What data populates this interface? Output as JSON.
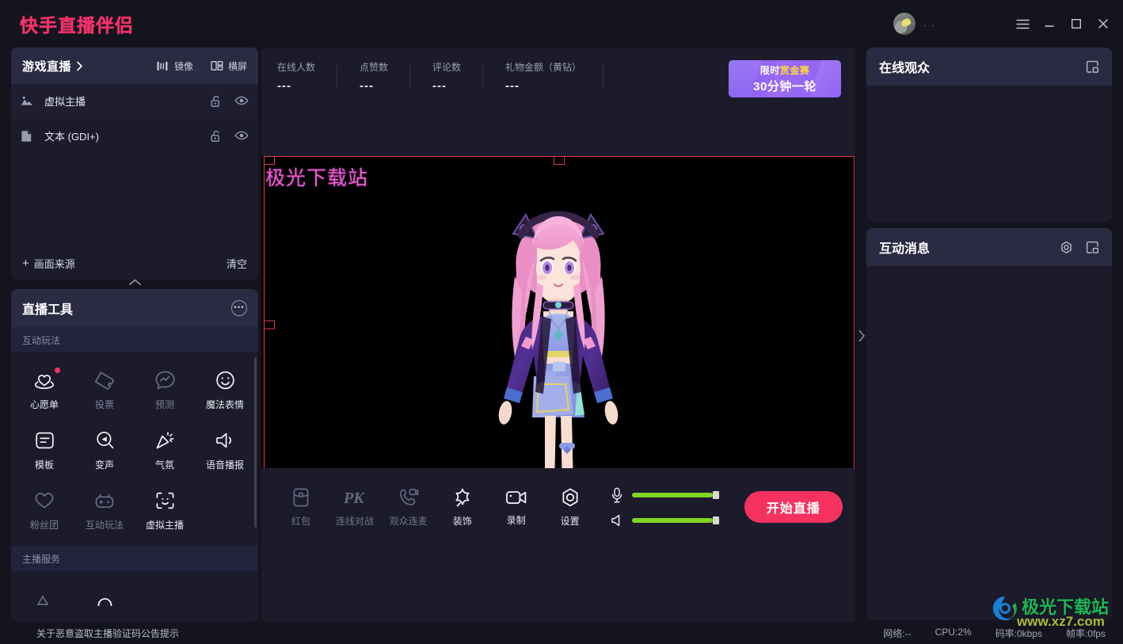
{
  "app": {
    "brand": "快手直播伴侣",
    "username": ". ."
  },
  "titlebar": {
    "menu_icon": "hamburger-menu-icon",
    "minimize_icon": "minimize-icon",
    "maximize_icon": "maximize-icon",
    "close_icon": "close-icon"
  },
  "sidebar": {
    "scene": {
      "title": "游戏直播",
      "chevron_icon": "chevron-right-icon",
      "actions": [
        {
          "label": "镜像",
          "icon": "mirror-icon"
        },
        {
          "label": "横屏",
          "icon": "landscape-icon"
        }
      ]
    },
    "sources": [
      {
        "name": "虚拟主播",
        "icon": "image-icon",
        "lock_icon": "unlock-icon",
        "eye_icon": "eye-visible-icon"
      },
      {
        "name": "文本 (GDI+)",
        "icon": "text-source-icon",
        "lock_icon": "unlock-icon",
        "eye_icon": "eye-visible-icon"
      }
    ],
    "sources_footer": {
      "add_label": "画面来源",
      "add_icon": "plus-icon",
      "clear_label": "清空"
    },
    "collapse_icon": "chevron-up-icon",
    "tools": {
      "title": "直播工具",
      "more_icon": "more-dots-icon",
      "groups": [
        {
          "label": "互动玩法",
          "items": [
            {
              "label": "心愿单",
              "icon": "wishlist-heart-icon",
              "dim": false,
              "badge": true
            },
            {
              "label": "投票",
              "icon": "vote-ticket-icon",
              "dim": true,
              "badge": false
            },
            {
              "label": "预测",
              "icon": "prediction-icon",
              "dim": true,
              "badge": false
            },
            {
              "label": "魔法表情",
              "icon": "magic-emoji-icon",
              "dim": false,
              "badge": false
            },
            {
              "label": "模板",
              "icon": "template-icon",
              "dim": false,
              "badge": false
            },
            {
              "label": "变声",
              "icon": "voice-changer-icon",
              "dim": false,
              "badge": false
            },
            {
              "label": "气氛",
              "icon": "confetti-icon",
              "dim": false,
              "badge": false
            },
            {
              "label": "语音播报",
              "icon": "speaker-announce-icon",
              "dim": false,
              "badge": false
            },
            {
              "label": "粉丝团",
              "icon": "fan-club-heart-icon",
              "dim": true,
              "badge": false
            },
            {
              "label": "互动玩法",
              "icon": "interactive-game-icon",
              "dim": true,
              "badge": false
            },
            {
              "label": "虚拟主播",
              "icon": "face-scan-icon",
              "dim": false,
              "badge": false
            }
          ]
        },
        {
          "label": "主播服务",
          "items": []
        }
      ]
    }
  },
  "center": {
    "stats": [
      {
        "label": "在线人数",
        "value": "---"
      },
      {
        "label": "点赞数",
        "value": "---"
      },
      {
        "label": "评论数",
        "value": "---"
      },
      {
        "label": "礼物金额（黄钻）",
        "value": "---"
      }
    ],
    "promo": {
      "line1_prefix": "限时",
      "line1_highlight": "赏金赛",
      "line2": "30分钟一轮",
      "highlight_color": "#ffd83d",
      "bg_color": "#8c63f2"
    },
    "preview": {
      "overlay_text": "极光下载站",
      "overlay_color": "#ef5ad8",
      "selection_color": "#e23c4e",
      "canvas_bg": "#000000"
    },
    "toolbar": [
      {
        "label": "红包",
        "icon": "red-packet-icon",
        "dim": true
      },
      {
        "label": "连线对战",
        "icon": "pk-battle-icon",
        "dim": true
      },
      {
        "label": "观众连麦",
        "icon": "audience-call-icon",
        "dim": true
      },
      {
        "label": "装饰",
        "icon": "decoration-star-icon",
        "dim": false
      },
      {
        "label": "录制",
        "icon": "record-camera-icon",
        "dim": false
      },
      {
        "label": "设置",
        "icon": "settings-gear-icon",
        "dim": false
      }
    ],
    "volume": {
      "mic": {
        "icon": "microphone-icon",
        "level": 92
      },
      "speaker": {
        "icon": "speaker-icon",
        "level": 92
      },
      "fill_color": "#80d423"
    },
    "go_live": {
      "label": "开始直播",
      "color": "#f5325f"
    },
    "expand_icon": "chevron-right-icon"
  },
  "right": {
    "panels": [
      {
        "title": "在线观众",
        "actions": [
          {
            "icon": "popout-window-icon"
          }
        ]
      },
      {
        "title": "互动消息",
        "actions": [
          {
            "icon": "settings-gear-icon"
          },
          {
            "icon": "popout-window-icon"
          }
        ]
      }
    ]
  },
  "statusbar": {
    "note": "关于恶意盗取主播验证码公告提示",
    "metrics": [
      "网络:--",
      "CPU:2%",
      "码率:0kbps",
      "帧率:0fps"
    ]
  },
  "watermark": {
    "main": "极光下载站",
    "sub": "www.xz7.com",
    "logo_icon": "aurora-swirl-logo-icon"
  }
}
